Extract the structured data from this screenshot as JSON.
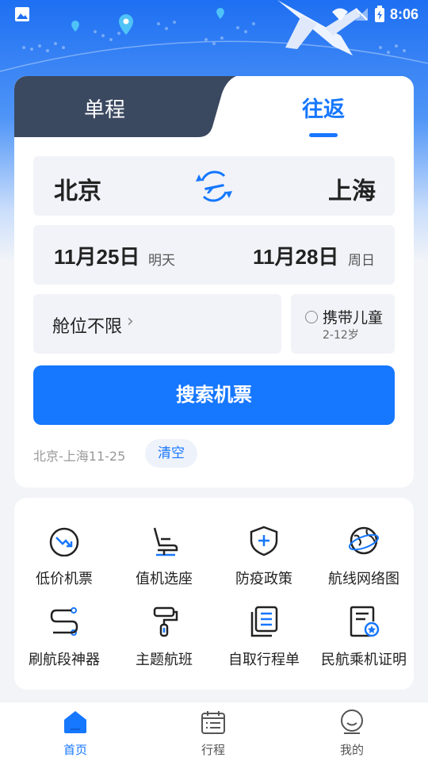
{
  "status_bar": {
    "time": "8:06",
    "icons": [
      "gallery-icon",
      "wifi-icon",
      "signal-off-icon",
      "battery-charging-icon"
    ]
  },
  "tabs": [
    {
      "label": "单程",
      "active": false
    },
    {
      "label": "往返",
      "active": true
    }
  ],
  "route": {
    "from": "北京",
    "to": "上海"
  },
  "dates": {
    "depart": {
      "date": "11月25日",
      "note": "明天"
    },
    "return": {
      "date": "11月28日",
      "note": "周日"
    }
  },
  "cabin": {
    "label": "舱位不限",
    "arrow": "›"
  },
  "child": {
    "label": "携带儿童",
    "age": "2-12岁",
    "checked": false
  },
  "search_button": "搜索机票",
  "history": {
    "entry": "北京-上海11-25",
    "clear": "清空"
  },
  "services": [
    {
      "label": "低价机票",
      "icon": "low-price-icon"
    },
    {
      "label": "值机选座",
      "icon": "seat-icon"
    },
    {
      "label": "防疫政策",
      "icon": "shield-plus-icon"
    },
    {
      "label": "航线网络图",
      "icon": "globe-icon"
    },
    {
      "label": "刷航段神器",
      "icon": "route-icon"
    },
    {
      "label": "主题航班",
      "icon": "roller-icon"
    },
    {
      "label": "自取行程单",
      "icon": "itinerary-icon"
    },
    {
      "label": "民航乘机证明",
      "icon": "certificate-icon"
    }
  ],
  "bottom_nav": [
    {
      "label": "首页",
      "active": true
    },
    {
      "label": "行程",
      "active": false
    },
    {
      "label": "我的",
      "active": false
    }
  ],
  "colors": {
    "accent": "#1677ff",
    "tab_dark": "#3a4860",
    "field_bg": "#f1f3f8"
  }
}
